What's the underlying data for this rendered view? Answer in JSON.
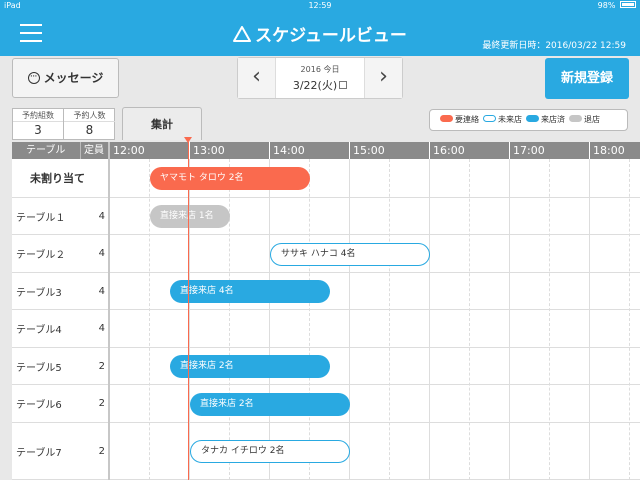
{
  "status_bar": {
    "carrier": "iPad",
    "time": "12:59",
    "battery": "98%"
  },
  "header": {
    "title": "スケジュールビュー",
    "last_updated": "最終更新日時：2016/03/22 12:59"
  },
  "toolbar": {
    "message_label": "メッセージ",
    "year_label": "2016 今日",
    "date_label": "3/22(火)",
    "prev_label": "‹",
    "next_label": "›",
    "new_label": "新規登録"
  },
  "summary": {
    "groups_label": "予約組数",
    "groups_value": "3",
    "people_label": "予約人数",
    "people_value": "8",
    "stats_label": "集計"
  },
  "legend": [
    {
      "label": "要連絡",
      "color": "#fa6a4e"
    },
    {
      "label": "未来店",
      "color": "#ffffff"
    },
    {
      "label": "来店済",
      "color": "#29a9e1"
    },
    {
      "label": "退店",
      "color": "#c6c6c6"
    }
  ],
  "grid": {
    "header_table": "テーブル",
    "header_capacity": "定員",
    "times": [
      "12:00",
      "13:00",
      "14:00",
      "15:00",
      "16:00",
      "17:00",
      "18:00"
    ],
    "rows": [
      {
        "name": "未割り当て",
        "capacity": ""
      },
      {
        "name": "テーブル１",
        "capacity": "4"
      },
      {
        "name": "テーブル２",
        "capacity": "4"
      },
      {
        "name": "テーブル3",
        "capacity": "4"
      },
      {
        "name": "テーブル4",
        "capacity": "4"
      },
      {
        "name": "テーブル5",
        "capacity": "2"
      },
      {
        "name": "テーブル6",
        "capacity": "2"
      },
      {
        "name": "テーブル7",
        "capacity": "2"
      }
    ],
    "bookings": [
      {
        "row": 0,
        "label": "ヤマモト タロウ 2名",
        "status": "contact"
      },
      {
        "row": 1,
        "label": "直接来店 1名",
        "status": "left"
      },
      {
        "row": 2,
        "label": "ササキ ハナコ 4名",
        "status": "notarrived"
      },
      {
        "row": 3,
        "label": "直接来店 4名",
        "status": "arrived"
      },
      {
        "row": 5,
        "label": "直接来店 2名",
        "status": "arrived"
      },
      {
        "row": 6,
        "label": "直接来店 2名",
        "status": "arrived"
      },
      {
        "row": 7,
        "label": "タナカ イチロウ 2名",
        "status": "notarrived"
      }
    ]
  }
}
